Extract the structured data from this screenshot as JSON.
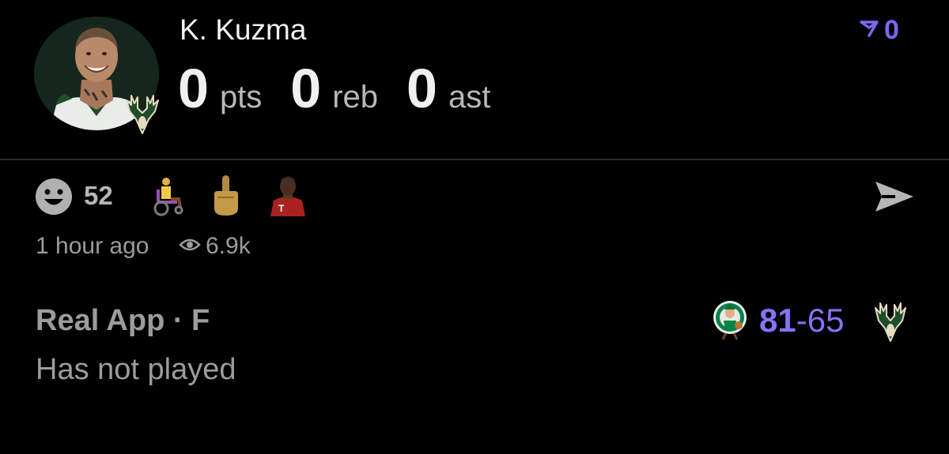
{
  "player": {
    "name": "K. Kuzma",
    "avatar_icon": "player-headshot",
    "team_badge_icon": "bucks-logo"
  },
  "stats": [
    {
      "value": "0",
      "unit": "pts"
    },
    {
      "value": "0",
      "unit": "reb"
    },
    {
      "value": "0",
      "unit": "ast"
    }
  ],
  "vote": {
    "icon": "upvote-arrow-icon",
    "count": "0"
  },
  "reactions": {
    "smiley_icon": "smiley-icon",
    "count": "52",
    "emojis": [
      "wheelchair-emoji",
      "middle-finger-emoji",
      "person-emoji"
    ]
  },
  "share_icon": "send-icon",
  "meta": {
    "time_ago": "1 hour ago",
    "views": "6.9k",
    "views_icon": "eye-icon"
  },
  "footer": {
    "source": "Real App · F",
    "status": "Has not played"
  },
  "game": {
    "home_team_icon": "celtics-logo",
    "home_score": "81",
    "separator": "-",
    "away_score": "65",
    "away_team_icon": "bucks-logo"
  },
  "colors": {
    "background": "#000000",
    "accent": "#7d66f0",
    "muted_text": "#9c9c9c",
    "bucks_green": "#1e4d2b",
    "celtics_green": "#008348"
  }
}
